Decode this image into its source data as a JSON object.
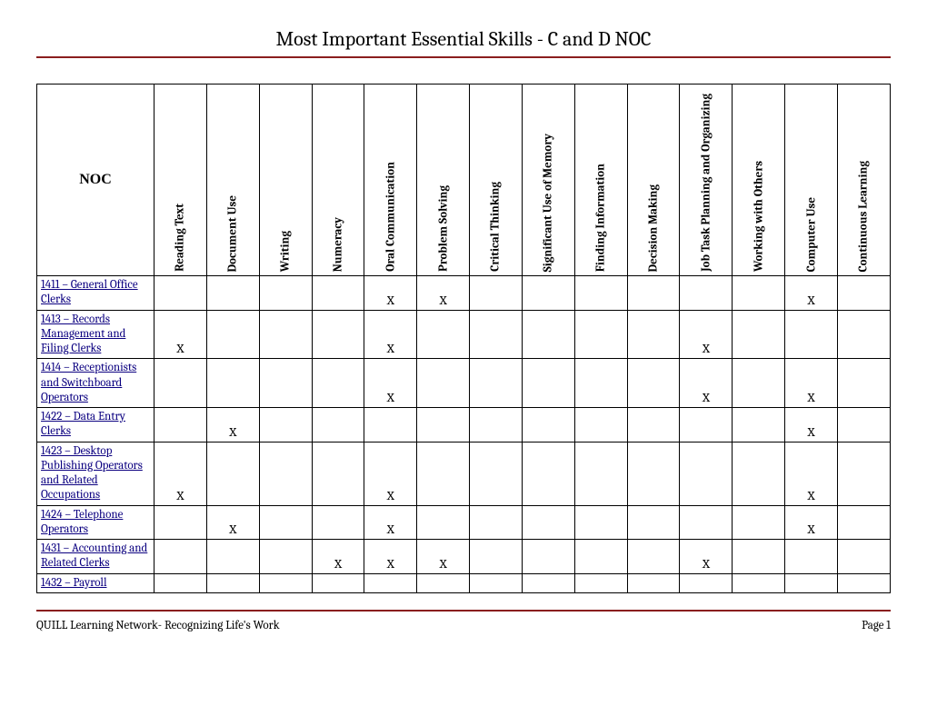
{
  "title": "Most Important Essential Skills - C and D NOC",
  "columns": {
    "noc": "NOC",
    "skills": [
      "Reading Text",
      "Document Use",
      "Writing",
      "Numeracy",
      "Oral Communication",
      "Problem Solving",
      "Critical Thinking",
      "Significant Use of Memory",
      "Finding Information",
      "Decision Making",
      "Job Task Planning and Organizing",
      "Working with Others",
      "Computer Use",
      "Continuous Learning"
    ]
  },
  "mark": "X",
  "rows": [
    {
      "noc": "1411 – General Office Clerks",
      "marks": [
        "",
        "",
        "",
        "",
        "X",
        "X",
        "",
        "",
        "",
        "",
        "",
        "",
        "X",
        ""
      ]
    },
    {
      "noc": "1413 – Records Management and Filing Clerks",
      "marks": [
        "X",
        "",
        "",
        "",
        "X",
        "",
        "",
        "",
        "",
        "",
        "X",
        "",
        "",
        ""
      ]
    },
    {
      "noc": "1414 – Receptionists and Switchboard Operators",
      "marks": [
        "",
        "",
        "",
        "",
        "X",
        "",
        "",
        "",
        "",
        "",
        "X",
        "",
        "X",
        ""
      ]
    },
    {
      "noc": "1422 – Data Entry Clerks",
      "marks": [
        "",
        "X",
        "",
        "",
        "",
        "",
        "",
        "",
        "",
        "",
        "",
        "",
        "X",
        ""
      ]
    },
    {
      "noc": "1423 – Desktop Publishing Operators and Related Occupations",
      "marks": [
        "X",
        "",
        "",
        "",
        "X",
        "",
        "",
        "",
        "",
        "",
        "",
        "",
        "X",
        ""
      ]
    },
    {
      "noc": "1424 – Telephone Operators",
      "marks": [
        "",
        "X",
        "",
        "",
        "X",
        "",
        "",
        "",
        "",
        "",
        "",
        "",
        "X",
        ""
      ]
    },
    {
      "noc": "1431 – Accounting and Related Clerks",
      "marks": [
        "",
        "",
        "",
        "X",
        "X",
        "X",
        "",
        "",
        "",
        "",
        "X",
        "",
        "",
        ""
      ]
    },
    {
      "noc": "1432 – Payroll ",
      "marks": [
        "",
        "",
        "",
        "",
        "",
        "",
        "",
        "",
        "",
        "",
        "",
        "",
        "",
        ""
      ]
    }
  ],
  "footer": {
    "left": "QUILL Learning Network- Recognizing Life's Work",
    "right": "Page 1"
  }
}
